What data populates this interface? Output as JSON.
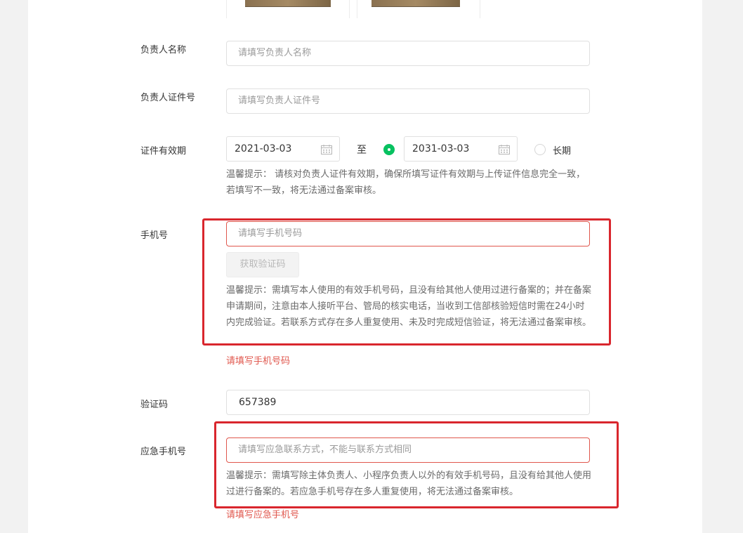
{
  "form": {
    "manager_name": {
      "label": "负责人名称",
      "placeholder": "请填写负责人名称"
    },
    "manager_id": {
      "label": "负责人证件号",
      "placeholder": "请填写负责人证件号"
    },
    "validity": {
      "label": "证件有效期",
      "start_date": "2021-03-03",
      "to": "至",
      "end_date": "2031-03-03",
      "long_term": "长期",
      "hint": "温馨提示： 请核对负责人证件有效期，确保所填写证件有效期与上传证件信息完全一致，若填写不一致，将无法通过备案审核。"
    },
    "phone": {
      "label": "手机号",
      "placeholder": "请填写手机号码",
      "get_code_button": "获取验证码",
      "hint": "温馨提示：需填写本人使用的有效手机号码，且没有给其他人使用过进行备案的；并在备案申请期间，注意由本人接听平台、管局的核实电话，当收到工信部核验短信时需在24小时内完成验证。若联系方式存在多人重复使用、未及时完成短信验证，将无法通过备案审核。",
      "error": "请填写手机号码"
    },
    "verify_code": {
      "label": "验证码",
      "value": "657389"
    },
    "emergency_phone": {
      "label": "应急手机号",
      "placeholder": "请填写应急联系方式，不能与联系方式相同",
      "hint": "温馨提示：需填写除主体负责人、小程序负责人以外的有效手机号码，且没有给其他人使用过进行备案的。若应急手机号存在多人重复使用，将无法通过备案审核。",
      "error": "请填写应急手机号"
    }
  },
  "colors": {
    "accent_green": "#07c160",
    "error_red": "#e0574d",
    "annotation_red": "#d9262d"
  }
}
